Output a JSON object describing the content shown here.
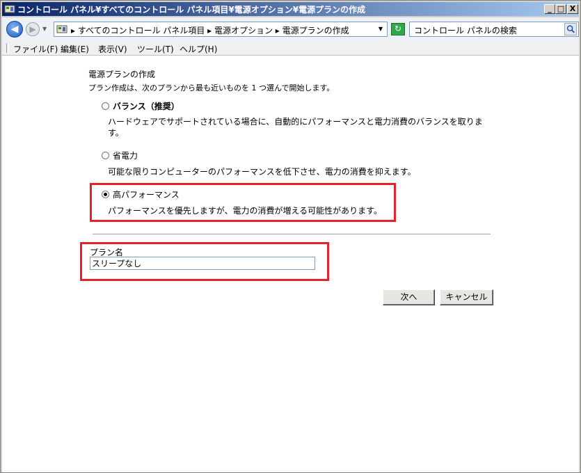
{
  "window": {
    "title": "コントロール パネル¥すべてのコントロール パネル項目¥電源オプション¥電源プランの作成",
    "minimize_glyph": "_",
    "maximize_glyph": "□",
    "close_glyph": "X"
  },
  "addressbar": {
    "crumbs": "▸ すべてのコントロール パネル項目 ▸ 電源オプション ▸ 電源プランの作成",
    "search_placeholder": "コントロール パネルの検索"
  },
  "menu": {
    "items": [
      "ファイル(F)",
      "編集(E)",
      "表示(V)",
      "ツール(T)",
      "ヘルプ(H)"
    ]
  },
  "main": {
    "heading": "電源プランの作成",
    "intro": "プラン作成は、次のプランから最も近いものを 1 つ選んで開始します。",
    "options": [
      {
        "label": "バランス（推奨）",
        "description": "ハードウェアでサポートされている場合に、自動的にパフォーマンスと電力消費のバランスを取ります。",
        "selected": false
      },
      {
        "label": "省電力",
        "description": "可能な限りコンピューターのパフォーマンスを低下させ、電力の消費を抑えます。",
        "selected": false
      },
      {
        "label": "高パフォーマンス",
        "description": "パフォーマンスを優先しますが、電力の消費が増える可能性があります。",
        "selected": true
      }
    ],
    "plan_name_label": "プラン名",
    "plan_name_value": "スリープなし",
    "next_button": "次へ",
    "cancel_button": "キャンセル"
  },
  "colors": {
    "highlight": "#e8202a",
    "titlebar_start": "#0a246a",
    "titlebar_end": "#a6caf0"
  }
}
